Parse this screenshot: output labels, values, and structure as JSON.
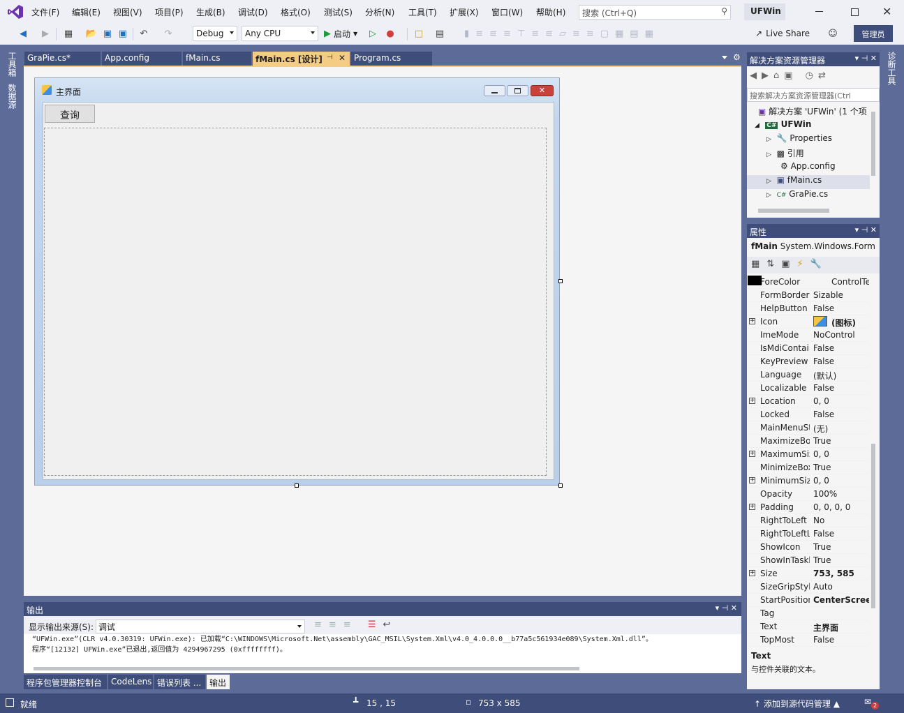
{
  "title": {
    "app_name": "UFWin",
    "search_placeholder": "搜索 (Ctrl+Q)"
  },
  "menu": [
    "文件(F)",
    "编辑(E)",
    "视图(V)",
    "项目(P)",
    "生成(B)",
    "调试(D)",
    "格式(O)",
    "测试(S)",
    "分析(N)",
    "工具(T)",
    "扩展(X)",
    "窗口(W)",
    "帮助(H)"
  ],
  "toolbar": {
    "config": "Debug",
    "platform": "Any CPU",
    "start": "启动",
    "live_share": "Live Share",
    "admin": "管理员"
  },
  "left_rail": [
    "工具箱",
    "数据源"
  ],
  "right_rail": [
    "诊断工具"
  ],
  "tabs": [
    {
      "label": "GraPie.cs*"
    },
    {
      "label": "App.config"
    },
    {
      "label": "fMain.cs"
    },
    {
      "label": "fMain.cs [设计]"
    },
    {
      "label": "Program.cs"
    }
  ],
  "form": {
    "title": "主界面",
    "button": "查询"
  },
  "solution": {
    "header": "解决方案资源管理器",
    "search": "搜索解决方案资源管理器(Ctrl",
    "items": [
      "解决方案 'UFWin' (1 个项",
      "UFWin",
      "Properties",
      "引用",
      "App.config",
      "fMain.cs",
      "GraPie.cs"
    ]
  },
  "properties": {
    "header": "属性",
    "object": "fMain",
    "type": "System.Windows.Form",
    "rows": [
      {
        "n": "ForeColor",
        "v": "ControlText",
        "exp": false,
        "swatch": "#000000"
      },
      {
        "n": "FormBorderStyle",
        "v": "Sizable",
        "exp": false
      },
      {
        "n": "HelpButton",
        "v": "False",
        "exp": false
      },
      {
        "n": "Icon",
        "v": "(图标)",
        "exp": true,
        "bold": true
      },
      {
        "n": "ImeMode",
        "v": "NoControl",
        "exp": false
      },
      {
        "n": "IsMdiContainer",
        "v": "False",
        "exp": false
      },
      {
        "n": "KeyPreview",
        "v": "False",
        "exp": false
      },
      {
        "n": "Language",
        "v": "(默认)",
        "exp": false
      },
      {
        "n": "Localizable",
        "v": "False",
        "exp": false
      },
      {
        "n": "Location",
        "v": "0, 0",
        "exp": true
      },
      {
        "n": "Locked",
        "v": "False",
        "exp": false
      },
      {
        "n": "MainMenuStrip",
        "v": "(无)",
        "exp": false
      },
      {
        "n": "MaximizeBox",
        "v": "True",
        "exp": false
      },
      {
        "n": "MaximumSize",
        "v": "0, 0",
        "exp": true
      },
      {
        "n": "MinimizeBox",
        "v": "True",
        "exp": false
      },
      {
        "n": "MinimumSize",
        "v": "0, 0",
        "exp": true
      },
      {
        "n": "Opacity",
        "v": "100%",
        "exp": false
      },
      {
        "n": "Padding",
        "v": "0, 0, 0, 0",
        "exp": true
      },
      {
        "n": "RightToLeft",
        "v": "No",
        "exp": false
      },
      {
        "n": "RightToLeftLayout",
        "v": "False",
        "exp": false
      },
      {
        "n": "ShowIcon",
        "v": "True",
        "exp": false
      },
      {
        "n": "ShowInTaskbar",
        "v": "True",
        "exp": false
      },
      {
        "n": "Size",
        "v": "753, 585",
        "exp": true,
        "bold": true
      },
      {
        "n": "SizeGripStyle",
        "v": "Auto",
        "exp": false
      },
      {
        "n": "StartPosition",
        "v": "CenterScreen",
        "exp": false,
        "bold": true
      },
      {
        "n": "Tag",
        "v": "",
        "exp": false
      },
      {
        "n": "Text",
        "v": "主界面",
        "exp": false,
        "bold": true
      },
      {
        "n": "TopMost",
        "v": "False",
        "exp": false
      }
    ],
    "desc_title": "Text",
    "desc": "与控件关联的文本。"
  },
  "output": {
    "header": "输出",
    "source_label": "显示输出来源(S):",
    "source": "调试",
    "lines": [
      "“UFWin.exe”(CLR v4.0.30319: UFWin.exe): 已加载“C:\\WINDOWS\\Microsoft.Net\\assembly\\GAC_MSIL\\System.Xml\\v4.0_4.0.0.0__b77a5c561934e089\\System.Xml.dll”。",
      "程序“[12132] UFWin.exe”已退出,返回值为 4294967295 (0xffffffff)。"
    ]
  },
  "bottom_tabs": [
    "程序包管理器控制台",
    "CodeLens",
    "错误列表 ...",
    "输出"
  ],
  "status": {
    "ready": "就绪",
    "pos": "15 , 15",
    "size": "753 x 585",
    "source_control": "添加到源代码管理",
    "notifications": "2"
  }
}
